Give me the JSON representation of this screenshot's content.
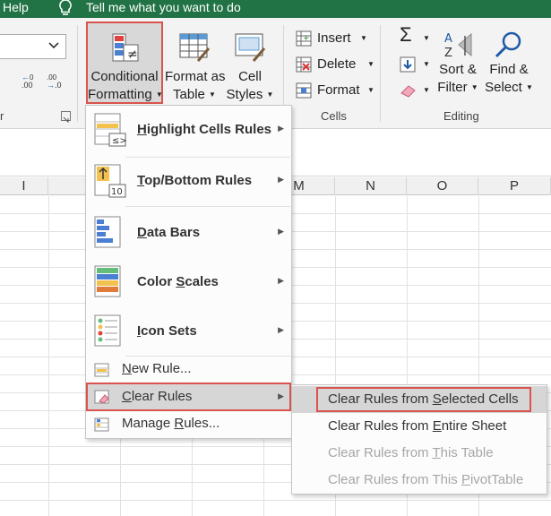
{
  "titlebar": {
    "help": "Help",
    "tell_me": "Tell me what you want to do"
  },
  "ribbon": {
    "number_group_label": "r",
    "increase_decimal": ".00",
    "decrease_decimal": ".0",
    "styles": {
      "conditional_formatting_line1": "Conditional",
      "conditional_formatting_line2": "Formatting",
      "format_as_table_line1": "Format as",
      "format_as_table_line2": "Table",
      "cell_styles_line1": "Cell",
      "cell_styles_line2": "Styles"
    },
    "cells": {
      "insert": "Insert",
      "delete": "Delete",
      "format": "Format",
      "group_label": "Cells"
    },
    "editing": {
      "sort_filter_line1": "Sort &",
      "sort_filter_line2": "Filter",
      "find_select_line1": "Find &",
      "find_select_line2": "Select",
      "group_label": "Editing"
    }
  },
  "columns": [
    "I",
    "",
    "",
    "",
    "M",
    "N",
    "O",
    "P"
  ],
  "cf_menu": {
    "highlight_pre": "",
    "highlight_key": "H",
    "highlight_post": "ighlight Cells Rules",
    "topbottom_pre": "",
    "topbottom_key": "T",
    "topbottom_post": "op/Bottom Rules",
    "databars_pre": "",
    "databars_key": "D",
    "databars_post": "ata Bars",
    "colorscales_pre": "Color ",
    "colorscales_key": "S",
    "colorscales_post": "cales",
    "iconsets_pre": "",
    "iconsets_key": "I",
    "iconsets_post": "con Sets",
    "newrule_pre": "",
    "newrule_key": "N",
    "newrule_post": "ew Rule...",
    "clearrules_pre": "",
    "clearrules_key": "C",
    "clearrules_post": "lear Rules",
    "managerules_pre": "Manage ",
    "managerules_key": "R",
    "managerules_post": "ules..."
  },
  "sub_menu": {
    "selected_pre": "Clear Rules from ",
    "selected_key": "S",
    "selected_post": "elected Cells",
    "entire_pre": "Clear Rules from ",
    "entire_key": "E",
    "entire_post": "ntire Sheet",
    "table_pre": "Clear Rules from ",
    "table_key": "T",
    "table_post": "his Table",
    "pivot_pre": "Clear Rules from This ",
    "pivot_key": "P",
    "pivot_post": "ivotTable"
  },
  "colors": {
    "excel_green": "#217346",
    "highlight_red": "#d9534f",
    "menu_hover": "#d6d6d6",
    "disabled_text": "#a6a6a6"
  }
}
